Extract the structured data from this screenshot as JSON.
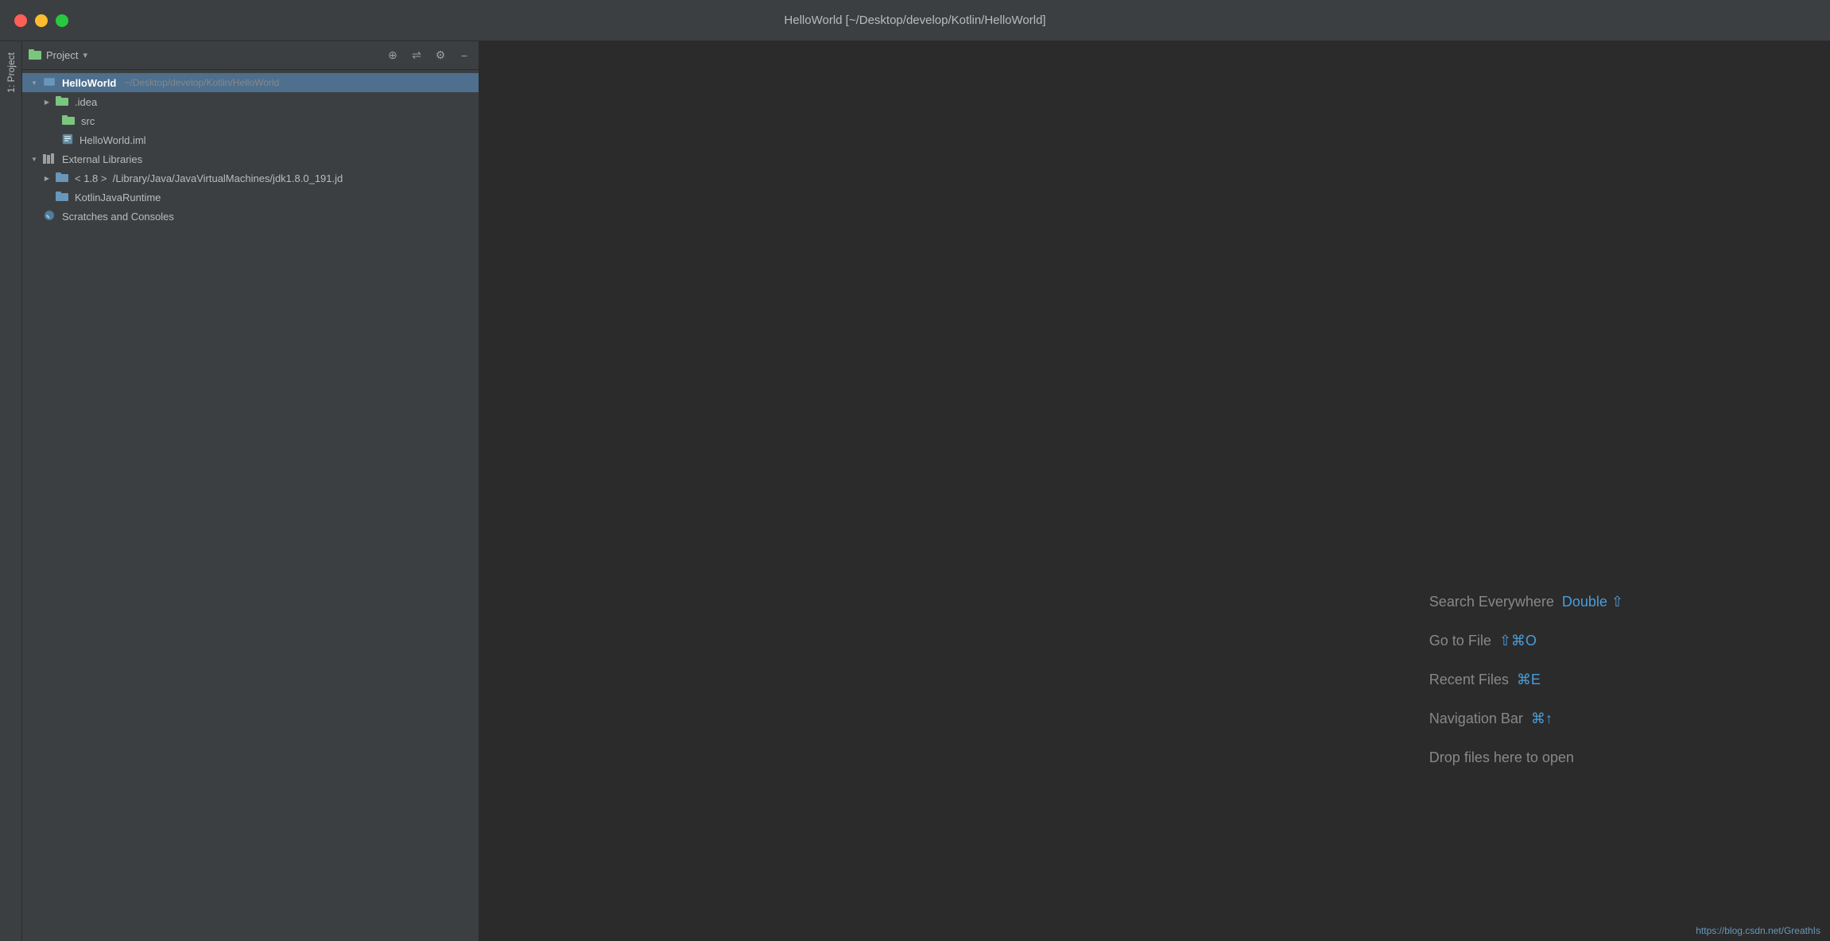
{
  "window": {
    "title": "HelloWorld [~/Desktop/develop/Kotlin/HelloWorld]"
  },
  "traffic_lights": {
    "close_label": "close",
    "minimize_label": "minimize",
    "maximize_label": "maximize"
  },
  "sidebar": {
    "header": {
      "title": "Project",
      "dropdown_arrow": "▾"
    },
    "toolbar": {
      "add_icon": "⊕",
      "layout_icon": "⇌",
      "settings_icon": "⚙",
      "minimize_icon": "−"
    },
    "tree": [
      {
        "id": "helloworld-root",
        "label": "HelloWorld",
        "sublabel": "~/Desktop/develop/Kotlin/HelloWorld",
        "indent": 0,
        "arrow": "down",
        "selected": true,
        "icon": "module-folder"
      },
      {
        "id": "idea",
        "label": ".idea",
        "indent": 1,
        "arrow": "right",
        "icon": "folder"
      },
      {
        "id": "src",
        "label": "src",
        "indent": 1,
        "arrow": "none",
        "icon": "folder-source"
      },
      {
        "id": "helloworld-iml",
        "label": "HelloWorld.iml",
        "indent": 1,
        "arrow": "none",
        "icon": "iml-file"
      },
      {
        "id": "external-libraries",
        "label": "External Libraries",
        "indent": 0,
        "arrow": "down",
        "icon": "libraries"
      },
      {
        "id": "jdk18",
        "label": "< 1.8 >  /Library/Java/JavaVirtualMachines/jdk1.8.0_191.jd",
        "indent": 1,
        "arrow": "right",
        "icon": "sdk-folder"
      },
      {
        "id": "kotlin-runtime",
        "label": "KotlinJavaRuntime",
        "indent": 1,
        "arrow": "none",
        "icon": "library-folder"
      },
      {
        "id": "scratches",
        "label": "Scratches and Consoles",
        "indent": 0,
        "arrow": "none",
        "icon": "scratches"
      }
    ]
  },
  "vertical_tabs": [
    {
      "id": "project",
      "label": "1: Project"
    }
  ],
  "editor": {
    "shortcuts": [
      {
        "id": "search-everywhere",
        "label": "Search Everywhere",
        "keys": "Double ⇧"
      },
      {
        "id": "go-to-file",
        "label": "Go to File",
        "keys": "⇧⌘O"
      },
      {
        "id": "recent-files",
        "label": "Recent Files",
        "keys": "⌘E"
      },
      {
        "id": "navigation-bar",
        "label": "Navigation Bar",
        "keys": "⌘↑"
      },
      {
        "id": "drop-files",
        "label": "Drop files here to open",
        "keys": ""
      }
    ]
  },
  "status_bar": {
    "url": "https://blog.csdn.net/GreathIs"
  }
}
